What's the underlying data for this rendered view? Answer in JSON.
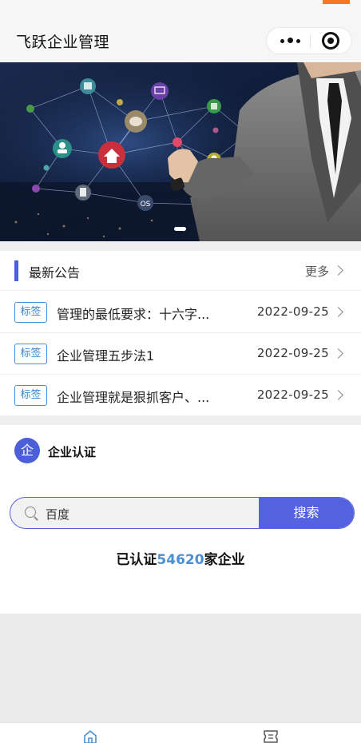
{
  "app": {
    "title": "飞跃企业管理"
  },
  "colors": {
    "accent": "#4b5fd9",
    "tag_blue": "#3a86d0",
    "search_button": "#5562e0",
    "page_background": "#efefef"
  },
  "capsule": {
    "more_icon": "more-dots-icon",
    "close_icon": "target-icon"
  },
  "banner": {
    "slide_count": 1,
    "active_slide": 1
  },
  "notices": {
    "title": "最新公告",
    "more_label": "更多",
    "items": [
      {
        "tag": "标签",
        "text": "管理的最低要求：十六字...",
        "date": "2022-09-25"
      },
      {
        "tag": "标签",
        "text": "企业管理五步法1",
        "date": "2022-09-25"
      },
      {
        "tag": "标签",
        "text": "企业管理就是狠抓客户、...",
        "date": "2022-09-25"
      }
    ]
  },
  "certification": {
    "icon_char": "企",
    "title": "企业认证",
    "search_value": "百度",
    "search_button": "搜索",
    "stat_prefix": "已认证",
    "stat_count": "54620",
    "stat_suffix": "家企业"
  },
  "tabbar": {
    "tabs": [
      {
        "icon": "home-icon",
        "active": true
      },
      {
        "icon": "ticket-icon",
        "active": false
      }
    ]
  }
}
